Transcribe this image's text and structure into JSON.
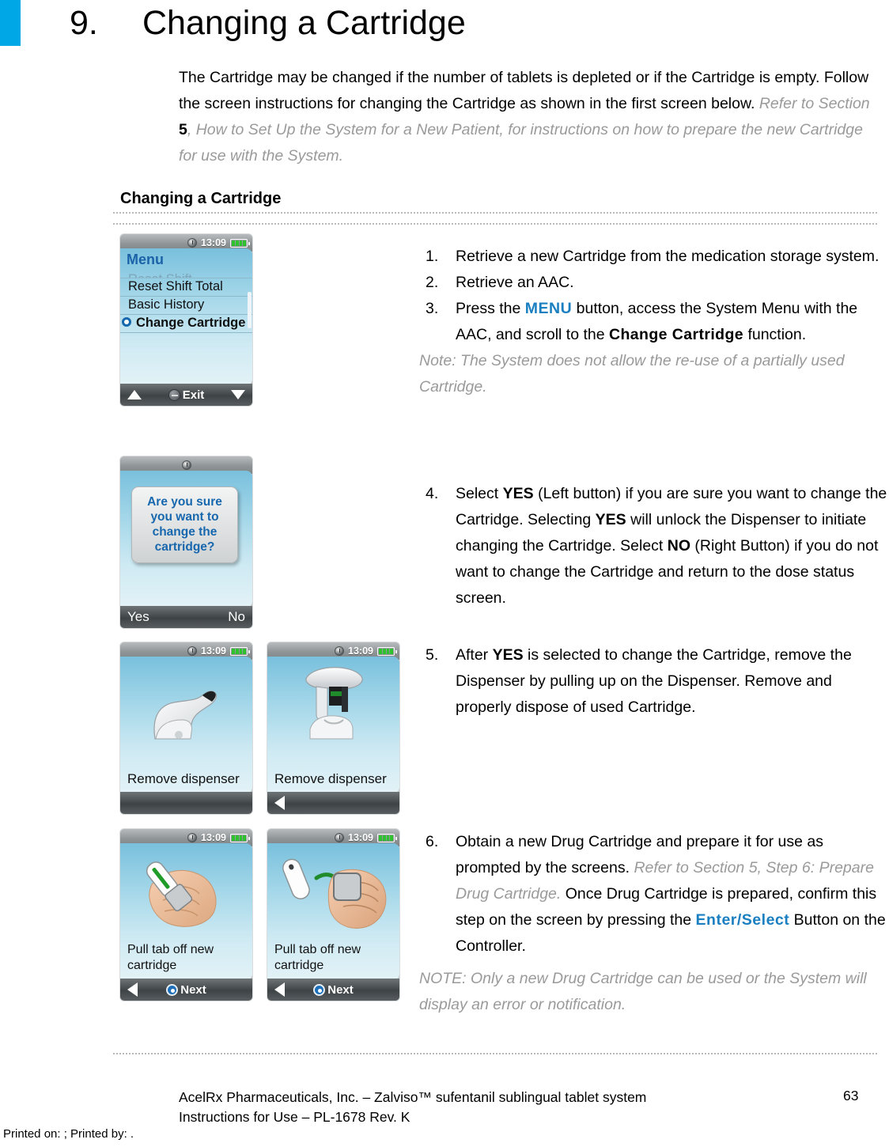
{
  "header": {
    "chapter_number": "9.",
    "chapter_title": "Changing a Cartridge"
  },
  "intro": {
    "line1": "The Cartridge may be changed if the number of tablets is depleted or if the Cartridge is empty.",
    "line2": "Follow the screen instructions for changing the Cartridge as shown in the first screen below.",
    "ref_pre": "Refer to Section ",
    "ref_num": "5",
    "ref_post": ", How to Set Up the System for a New Patient, for instructions on how to prepare the new Cartridge for use with the System."
  },
  "section_heading": "Changing a Cartridge",
  "steps": [
    {
      "number": "1.",
      "text": "Retrieve a new Cartridge from the medication storage system."
    },
    {
      "number": "2.",
      "text": "Retrieve an AAC."
    },
    {
      "number": "3.",
      "part_a": "Press the ",
      "kw1": "MENU",
      "part_b": " button, access the System Menu with the AAC, and scroll to the ",
      "kw2": "Change Cartridge",
      "part_c": " function."
    },
    {
      "number": "4.",
      "part_a": "Select ",
      "kw1": "YES",
      "part_b": " (Left button) if you are sure you want to change the Cartridge. Selecting ",
      "kw2": "YES",
      "part_c": " will unlock the Dispenser to initiate changing the Cartridge.  Select ",
      "kw3": "NO",
      "part_d": " (Right Button) if you do not want to change the Cartridge and return to the dose status screen."
    },
    {
      "number": "5.",
      "part_a": "After ",
      "kw1": "YES",
      "part_b": " is selected to change the Cartridge, remove the Dispenser by pulling up on the Dispenser.  Remove and properly dispose of used Cartridge."
    },
    {
      "number": "6.",
      "part_a": "Obtain a new Drug Cartridge and prepare it for use as prompted by the screens. ",
      "italic": "Refer to Section 5, Step 6: Prepare Drug Cartridge.",
      "part_b": "  Once Drug Cartridge is prepared, confirm this step on the screen by pressing the ",
      "kw1": "Enter/Select",
      "part_c": " Button on the Controller."
    }
  ],
  "notes": {
    "note1_label": "Note:",
    "note1_text": "  The System does not allow the re-use of a partially used Cartridge.",
    "note2": "NOTE: Only a new Drug Cartridge can be used or the System will display an error or notification."
  },
  "screens": {
    "menu": {
      "clock_time": "13:09",
      "title": "Menu",
      "clipped_item": "Reset Shift",
      "items": [
        "Reset Shift Total",
        "Basic History"
      ],
      "selected_item": "Change Cartridge",
      "soft_exit": "Exit"
    },
    "confirm": {
      "message": "Are you sure you want to change the cartridge?",
      "soft_left": "Yes",
      "soft_right": "No"
    },
    "remove_dispenser_a": {
      "clock_time": "13:09",
      "caption": "Remove dispenser"
    },
    "remove_dispenser_b": {
      "clock_time": "13:09",
      "caption": "Remove dispenser"
    },
    "pull_tab_a": {
      "clock_time": "13:09",
      "caption": "Pull tab off new cartridge",
      "soft_next": "Next"
    },
    "pull_tab_b": {
      "clock_time": "13:09",
      "caption": "Pull tab off new cartridge",
      "soft_next": "Next"
    }
  },
  "footer": {
    "line1": "AcelRx Pharmaceuticals, Inc. – Zalviso™ sufentanil sublingual tablet system",
    "line2": "Instructions for Use – PL-1678 Rev. K",
    "page_number": "63",
    "printed": "Printed on: ; Printed by: ."
  },
  "colors": {
    "accent_blue": "#00a7e6",
    "link_blue": "#1a7fc1",
    "gray_italic": "#9a9a9a"
  }
}
